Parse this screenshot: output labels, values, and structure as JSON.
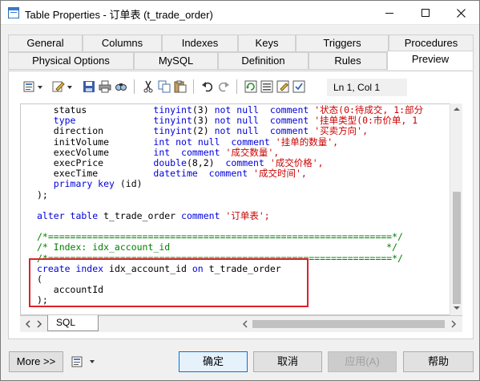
{
  "window": {
    "title": "Table Properties - 订单表 (t_trade_order)"
  },
  "tabs_row1": [
    "General",
    "Columns",
    "Indexes",
    "Keys",
    "Triggers",
    "Procedures"
  ],
  "tabs_row2": [
    "Physical Options",
    "MySQL",
    "Definition",
    "Rules",
    "Preview"
  ],
  "active_tab": "Preview",
  "toolbar": {
    "icons": [
      "properties-icon",
      "edit-icon",
      "save-icon",
      "print-icon",
      "find-icon",
      "cut-icon",
      "copy-icon",
      "paste-icon",
      "undo-icon",
      "redo-icon",
      "refresh-icon",
      "list-icon",
      "edit-sheet-icon",
      "check-icon"
    ],
    "position_label": "Ln 1, Col 1"
  },
  "code_lines": [
    [
      {
        "t": "   status            ",
        "c": "pl"
      },
      {
        "t": "tinyint",
        "c": "ty"
      },
      {
        "t": "(3) ",
        "c": "pl"
      },
      {
        "t": "not null",
        "c": "kw"
      },
      {
        "t": "  ",
        "c": "pl"
      },
      {
        "t": "comment",
        "c": "kw"
      },
      {
        "t": " '状态(0:待成交, 1:部分",
        "c": "st"
      }
    ],
    [
      {
        "t": "   ",
        "c": "pl"
      },
      {
        "t": "type",
        "c": "kw"
      },
      {
        "t": "              ",
        "c": "pl"
      },
      {
        "t": "tinyint",
        "c": "ty"
      },
      {
        "t": "(3) ",
        "c": "pl"
      },
      {
        "t": "not null",
        "c": "kw"
      },
      {
        "t": "  ",
        "c": "pl"
      },
      {
        "t": "comment",
        "c": "kw"
      },
      {
        "t": " '挂单类型(0:市价单, 1",
        "c": "st"
      }
    ],
    [
      {
        "t": "   direction         ",
        "c": "pl"
      },
      {
        "t": "tinyint",
        "c": "ty"
      },
      {
        "t": "(2) ",
        "c": "pl"
      },
      {
        "t": "not null",
        "c": "kw"
      },
      {
        "t": "  ",
        "c": "pl"
      },
      {
        "t": "comment",
        "c": "kw"
      },
      {
        "t": " '买卖方向',",
        "c": "st"
      }
    ],
    [
      {
        "t": "   initVolume        ",
        "c": "pl"
      },
      {
        "t": "int",
        "c": "ty"
      },
      {
        "t": " ",
        "c": "pl"
      },
      {
        "t": "not null",
        "c": "kw"
      },
      {
        "t": "  ",
        "c": "pl"
      },
      {
        "t": "comment",
        "c": "kw"
      },
      {
        "t": " '挂单的数量',",
        "c": "st"
      }
    ],
    [
      {
        "t": "   execVolume        ",
        "c": "pl"
      },
      {
        "t": "int",
        "c": "ty"
      },
      {
        "t": "  ",
        "c": "pl"
      },
      {
        "t": "comment",
        "c": "kw"
      },
      {
        "t": " '成交数量',",
        "c": "st"
      }
    ],
    [
      {
        "t": "   execPrice         ",
        "c": "pl"
      },
      {
        "t": "double",
        "c": "ty"
      },
      {
        "t": "(8,2)  ",
        "c": "pl"
      },
      {
        "t": "comment",
        "c": "kw"
      },
      {
        "t": " '成交价格',",
        "c": "st"
      }
    ],
    [
      {
        "t": "   execTime          ",
        "c": "pl"
      },
      {
        "t": "datetime",
        "c": "ty"
      },
      {
        "t": "  ",
        "c": "pl"
      },
      {
        "t": "comment",
        "c": "kw"
      },
      {
        "t": " '成交时间',",
        "c": "st"
      }
    ],
    [
      {
        "t": "   ",
        "c": "pl"
      },
      {
        "t": "primary key",
        "c": "kw"
      },
      {
        "t": " (id)",
        "c": "pl"
      }
    ],
    [
      {
        "t": ");",
        "c": "pl"
      }
    ],
    [
      {
        "t": "",
        "c": "pl"
      }
    ],
    [
      {
        "t": "alter table",
        "c": "kw"
      },
      {
        "t": " t_trade_order ",
        "c": "pl"
      },
      {
        "t": "comment",
        "c": "kw"
      },
      {
        "t": " '订单表';",
        "c": "st"
      }
    ],
    [
      {
        "t": "",
        "c": "pl"
      }
    ],
    [
      {
        "t": "/*==============================================================*/",
        "c": "cm"
      }
    ],
    [
      {
        "t": "/* Index: idx_account_id                                       */",
        "c": "cm"
      }
    ],
    [
      {
        "t": "/*==============================================================*/",
        "c": "cm"
      }
    ],
    [
      {
        "t": "create index",
        "c": "kw"
      },
      {
        "t": " idx_account_id ",
        "c": "pl"
      },
      {
        "t": "on",
        "c": "kw"
      },
      {
        "t": " t_trade_order",
        "c": "pl"
      }
    ],
    [
      {
        "t": "(",
        "c": "pl"
      }
    ],
    [
      {
        "t": "   accountId",
        "c": "pl"
      }
    ],
    [
      {
        "t": ");",
        "c": "pl"
      }
    ]
  ],
  "sheet_tab": "SQL",
  "buttons": {
    "more": "More >>",
    "ok": "确定",
    "cancel": "取消",
    "apply": "应用(A)",
    "help": "帮助"
  }
}
